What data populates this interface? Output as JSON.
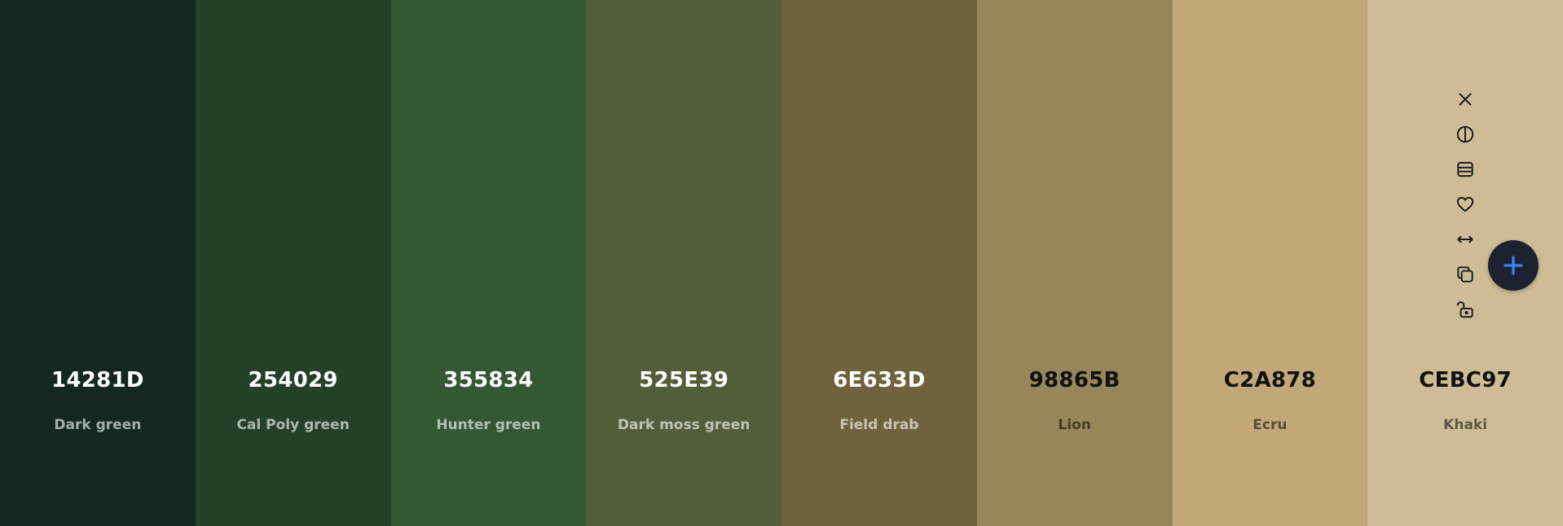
{
  "swatches": [
    {
      "hex": "14281D",
      "name": "Dark green",
      "color": "#14281D",
      "text_theme": "light"
    },
    {
      "hex": "254029",
      "name": "Cal Poly green",
      "color": "#254029",
      "text_theme": "light"
    },
    {
      "hex": "355834",
      "name": "Hunter green",
      "color": "#355834",
      "text_theme": "light"
    },
    {
      "hex": "525E39",
      "name": "Dark moss green",
      "color": "#525E39",
      "text_theme": "light"
    },
    {
      "hex": "6E633D",
      "name": "Field drab",
      "color": "#6E633D",
      "text_theme": "light"
    },
    {
      "hex": "98865B",
      "name": "Lion",
      "color": "#98865B",
      "text_theme": "dark"
    },
    {
      "hex": "C2A878",
      "name": "Ecru",
      "color": "#C2A878",
      "text_theme": "dark"
    },
    {
      "hex": "CEBC97",
      "name": "Khaki",
      "color": "#CEBC97",
      "text_theme": "dark"
    }
  ],
  "swatch_tools": {
    "attached_to_swatch": 7,
    "icons": [
      "close-icon",
      "contrast-icon",
      "shades-icon",
      "heart-icon",
      "drag-icon",
      "copy-icon",
      "unlock-icon"
    ]
  },
  "add_button": {
    "icon": "plus-icon",
    "icon_color": "#3b82f6",
    "background": "#1d2230"
  }
}
